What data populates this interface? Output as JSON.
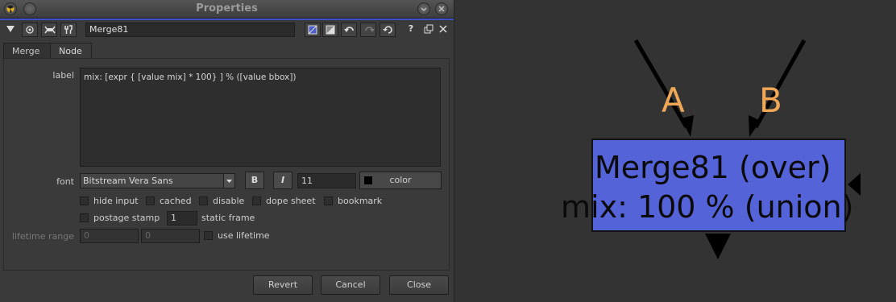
{
  "window": {
    "title": "Properties"
  },
  "toolbar": {
    "node_name": "Merge81",
    "help_label": "?"
  },
  "tabs": [
    {
      "label": "Merge"
    },
    {
      "label": "Node"
    }
  ],
  "node_tab": {
    "label_label": "label",
    "label_value": "mix: [expr { [value mix] * 100} ] %  ([value bbox])",
    "font_label": "font",
    "font_value": "Bitstream Vera Sans",
    "bold_label": "B",
    "italic_label": "I",
    "font_size": "11",
    "color_label": "color",
    "checkboxes": {
      "hide_input": "hide input",
      "cached": "cached",
      "disable": "disable",
      "dope_sheet": "dope sheet",
      "bookmark": "bookmark",
      "postage_stamp": "postage stamp",
      "use_lifetime": "use lifetime"
    },
    "static_frame_value": "1",
    "static_frame_label": "static frame",
    "lifetime_label": "lifetime range",
    "lifetime_start": "0",
    "lifetime_end": "0"
  },
  "buttons": {
    "revert": "Revert",
    "cancel": "Cancel",
    "close": "Close"
  },
  "graph": {
    "input_a": "A",
    "input_b": "B",
    "node_title": "Merge81 (over)",
    "node_sub": "mix: 100 %  (union)",
    "node_color": "#5463d8",
    "label_color": "#f0a856"
  }
}
